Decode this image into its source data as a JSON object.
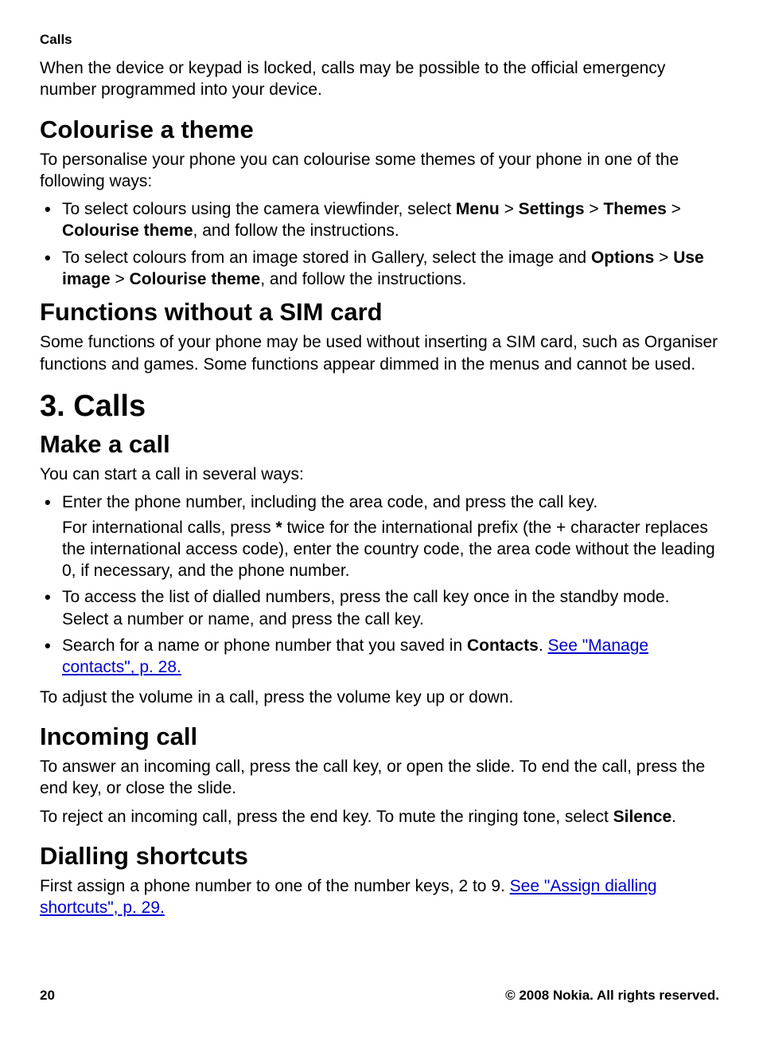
{
  "header": {
    "section": "Calls"
  },
  "intro": {
    "para": "When the device or keypad is locked, calls may be possible to the official emergency number programmed into your device."
  },
  "colourise": {
    "heading": "Colourise a theme",
    "para": "To personalise your phone you can colourise some themes of your phone in one of the following ways:",
    "bullet1": {
      "pre": "To select colours using the camera viewfinder, select ",
      "menu": "Menu",
      "gt1": "  >  ",
      "settings": "Settings",
      "gt2": "  >  ",
      "themes": "Themes",
      "gt3": "  >  ",
      "colourise": "Colourise theme",
      "post": ", and follow the instructions."
    },
    "bullet2": {
      "pre": "To select colours from an image stored in Gallery, select the image and ",
      "options": "Options",
      "gt1": "  >  ",
      "useimage": "Use image",
      "gt2": "  >  ",
      "colourise": "Colourise theme",
      "post": ", and follow the instructions."
    }
  },
  "functions": {
    "heading": "Functions without a SIM card",
    "para": "Some functions of your phone may be used without inserting a SIM card, such as Organiser functions and games. Some functions appear dimmed in the menus and cannot be used."
  },
  "chapter": {
    "heading": "3.   Calls"
  },
  "makecall": {
    "heading": "Make a call",
    "para": "You can start a call in several ways:",
    "bullet1": {
      "line1": "Enter the phone number, including the area code, and press the call key.",
      "line2_pre": "For international calls, press ",
      "star": "*",
      "line2_post": " twice for the international prefix (the + character replaces the international access code), enter the country code, the area code without the leading 0, if necessary, and the phone number."
    },
    "bullet2": "To access the list of dialled numbers, press the call key once in the standby mode. Select a number or name, and press the call key.",
    "bullet3": {
      "pre": "Search for a name or phone number that you saved in ",
      "contacts": "Contacts",
      "dot": ". ",
      "link": "See \"Manage contacts\", p. 28."
    },
    "para2": "To adjust the volume in a call, press the volume key up or down."
  },
  "incoming": {
    "heading": "Incoming call",
    "para1": "To answer an incoming call, press the call key, or open the slide. To end the call, press the end key, or close the slide.",
    "para2_pre": "To reject an incoming call, press the end key. To mute the ringing tone, select ",
    "silence": "Silence",
    "para2_post": "."
  },
  "dialling": {
    "heading": "Dialling shortcuts",
    "para_pre": "First assign a phone number to one of the number keys, 2 to 9. ",
    "link": "See \"Assign dialling shortcuts\", p. 29."
  },
  "footer": {
    "page": "20",
    "copyright": "© 2008 Nokia. All rights reserved."
  }
}
